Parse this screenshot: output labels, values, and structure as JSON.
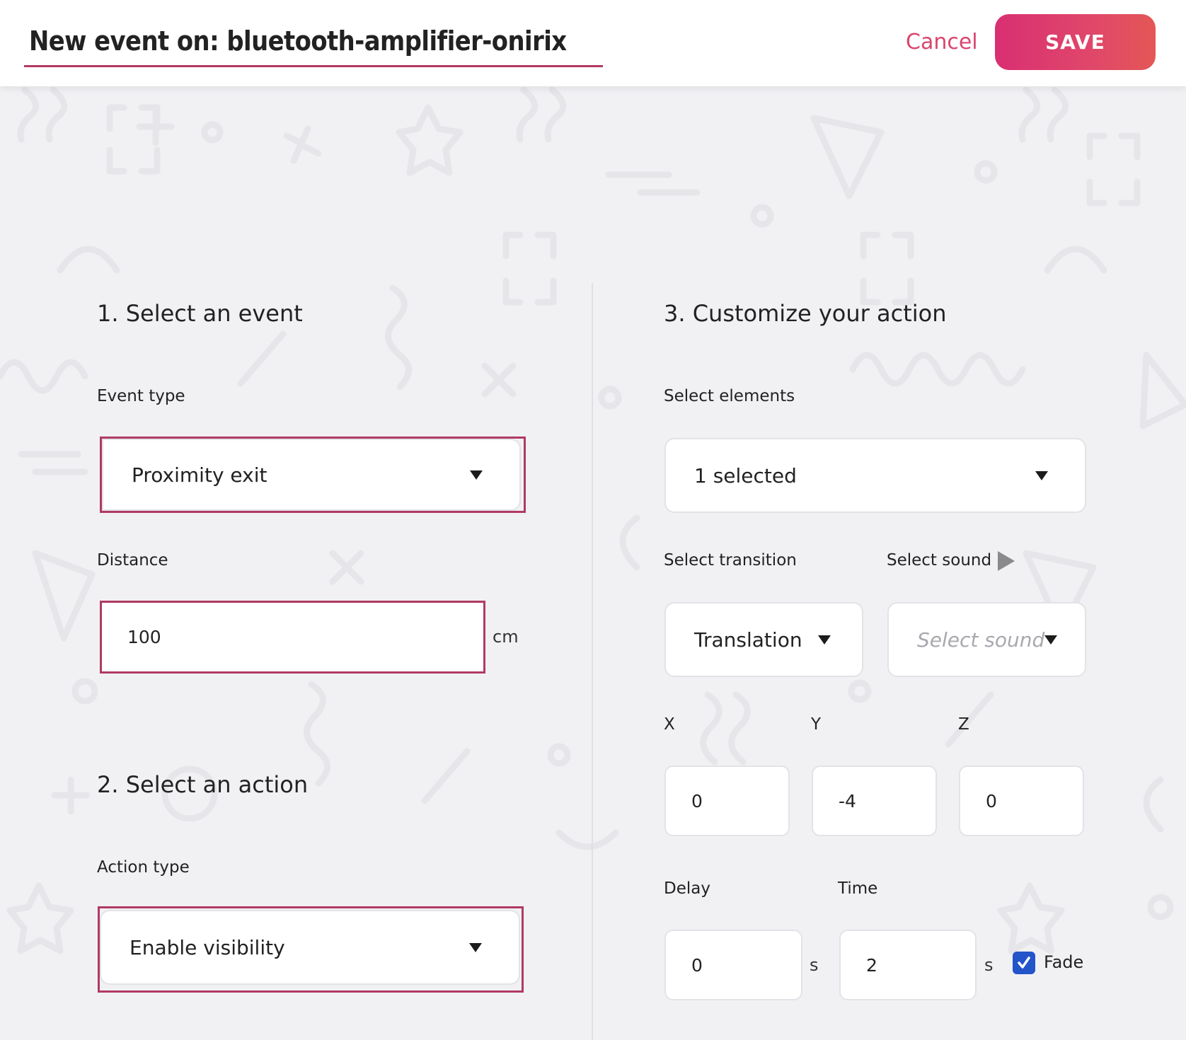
{
  "header": {
    "title": "New event on: bluetooth-amplifier-onirix",
    "cancel_label": "Cancel",
    "save_label": "SAVE",
    "accent_color": "#d9466f",
    "underline_color": "#b03a63"
  },
  "section1": {
    "heading": "1. Select an event",
    "event_type_label": "Event type",
    "event_type_value": "Proximity exit",
    "distance_label": "Distance",
    "distance_value": "100",
    "distance_unit": "cm"
  },
  "section2": {
    "heading": "2. Select an action",
    "action_type_label": "Action type",
    "action_type_value": "Enable visibility"
  },
  "section3": {
    "heading": "3. Customize your action",
    "select_elements_label": "Select elements",
    "select_elements_value": "1 selected",
    "select_transition_label": "Select transition",
    "transition_value": "Translation",
    "select_sound_label": "Select sound",
    "sound_placeholder": "Select sound",
    "x_label": "X",
    "y_label": "Y",
    "z_label": "Z",
    "x_value": "0",
    "y_value": "-4",
    "z_value": "0",
    "delay_label": "Delay",
    "delay_value": "0",
    "delay_unit": "s",
    "time_label": "Time",
    "time_value": "2",
    "time_unit": "s",
    "fade_label": "Fade",
    "fade_checked": true
  },
  "icons": {
    "dropdown": "caret-down-icon",
    "play": "play-icon",
    "check": "checkmark-icon"
  }
}
